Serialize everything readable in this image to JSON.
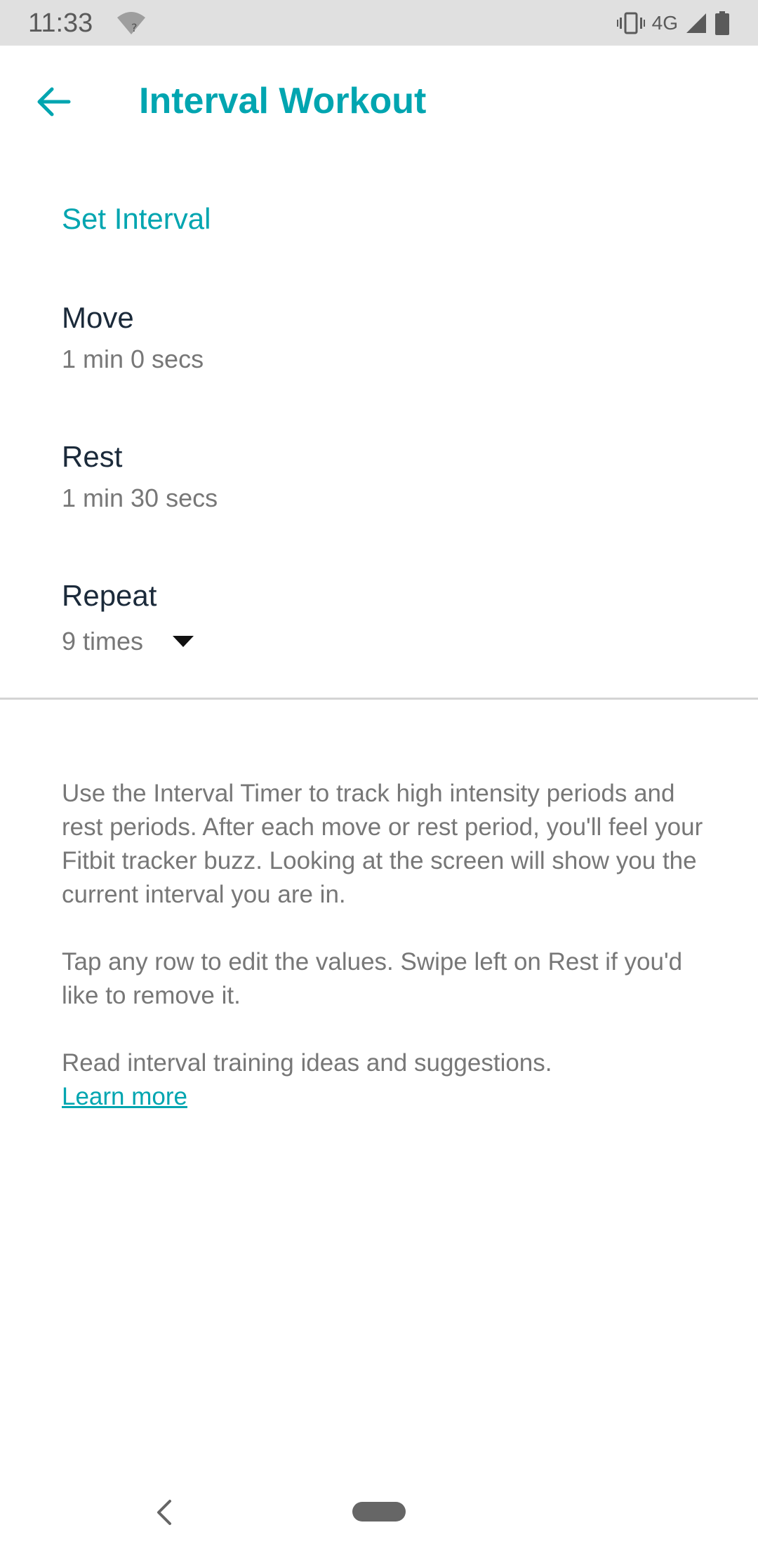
{
  "status_bar": {
    "time": "11:33",
    "network_label": "4G",
    "icons": [
      "wifi-unknown-icon",
      "vibrate-icon",
      "signal-icon",
      "battery-icon"
    ]
  },
  "header": {
    "title": "Interval Workout",
    "back_icon": "back-arrow-icon"
  },
  "colors": {
    "accent": "#00a5b0",
    "label": "#1b2a3a",
    "secondary_text": "#777777"
  },
  "section": {
    "title": "Set Interval"
  },
  "rows": [
    {
      "label": "Move",
      "value": "1 min 0 secs"
    },
    {
      "label": "Rest",
      "value": "1 min 30 secs"
    },
    {
      "label": "Repeat",
      "value": "9 times"
    }
  ],
  "info": {
    "paragraph_1": "Use the Interval Timer to track high intensity periods and rest periods. After each move or rest period, you'll feel your Fitbit tracker buzz. Looking at the screen will show you the current interval you are in.",
    "paragraph_2": "Tap any row to edit the values. Swipe left on Rest if you'd like to remove it.",
    "paragraph_3": "Read interval training ideas and suggestions.",
    "learn_more": "Learn more"
  },
  "nav_bar": {
    "icons": [
      "nav-back-icon",
      "nav-home-pill-icon"
    ]
  }
}
